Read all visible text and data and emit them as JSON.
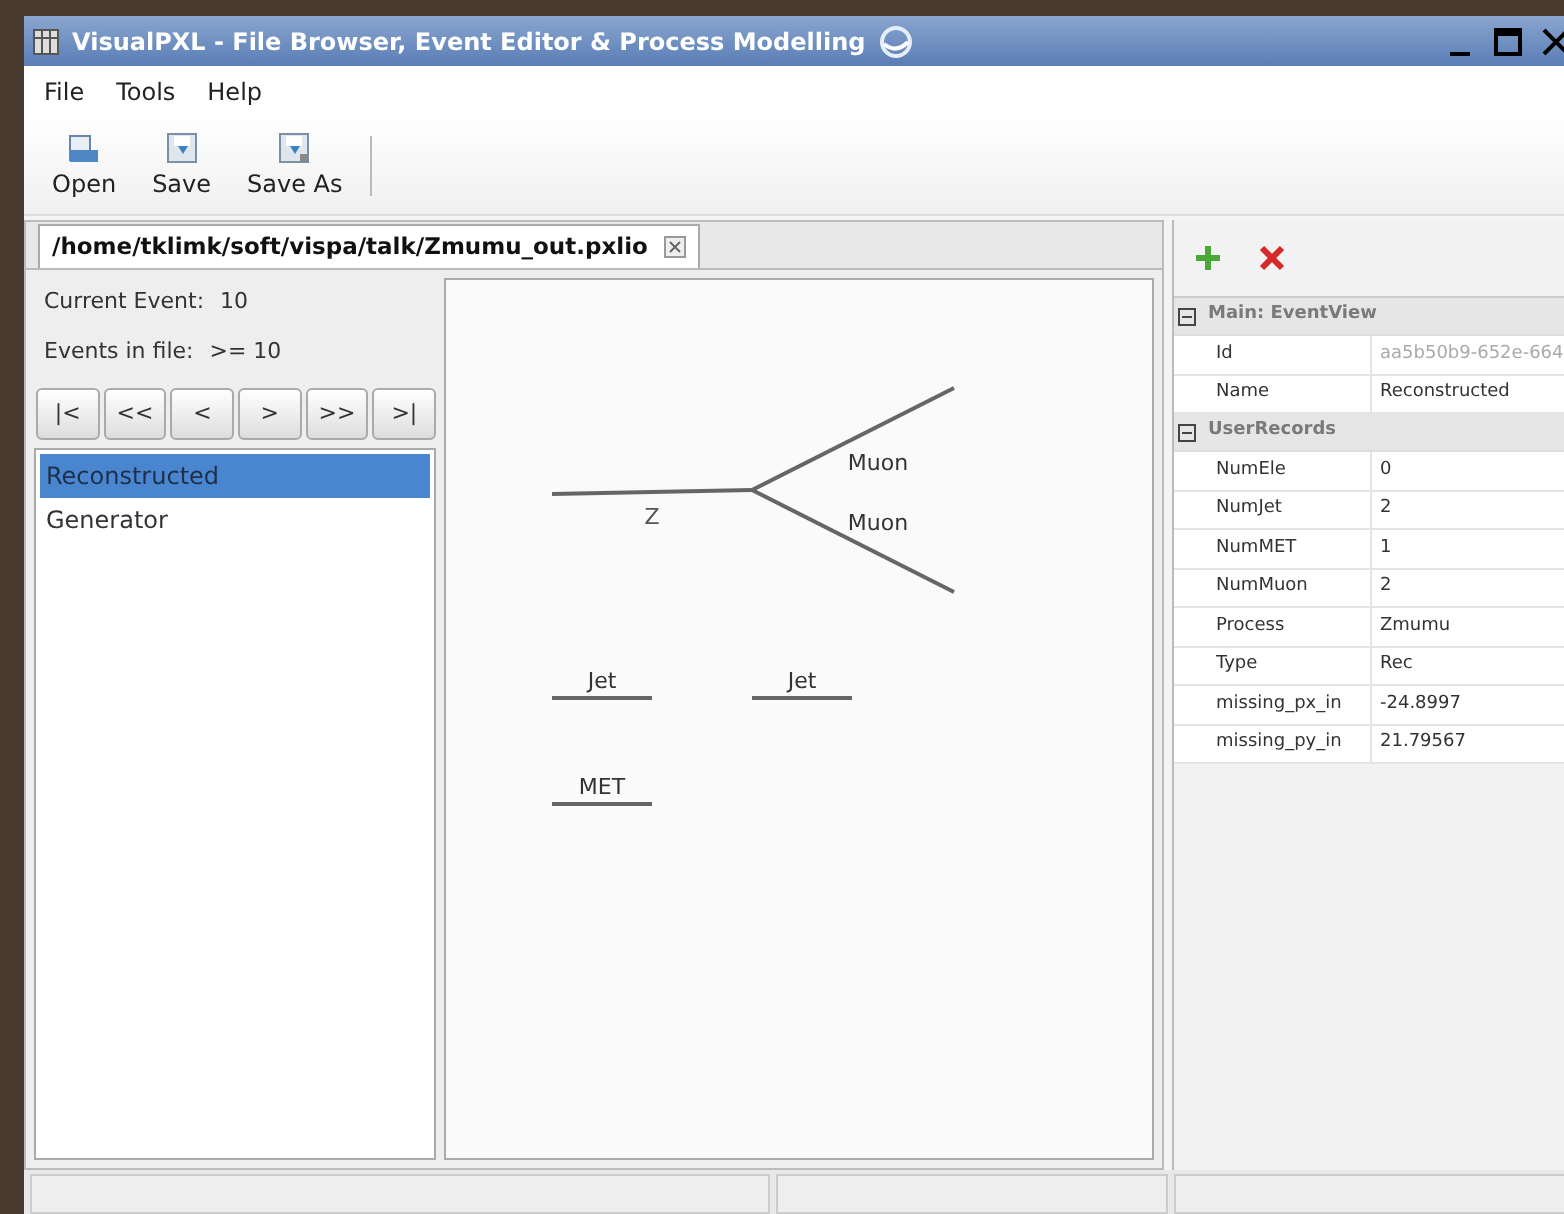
{
  "window": {
    "title": "VisualPXL - File Browser, Event Editor & Process Modelling"
  },
  "menu": [
    {
      "label": "File"
    },
    {
      "label": "Tools"
    },
    {
      "label": "Help"
    }
  ],
  "toolbar": [
    {
      "kind": "open",
      "label": "Open"
    },
    {
      "kind": "save",
      "label": "Save"
    },
    {
      "kind": "saveas",
      "label": "Save As"
    }
  ],
  "tabs": [
    {
      "label": "/home/tklimk/soft/vispa/talk/Zmumu_out.pxlio",
      "selected": true
    }
  ],
  "event_info": [
    {
      "label": "Current Event:",
      "value": "10"
    },
    {
      "label": "Events in file:",
      "value": ">= 10"
    }
  ],
  "nav_buttons": [
    "|<",
    "<<",
    "<",
    ">",
    ">>",
    ">|"
  ],
  "views": [
    {
      "label": "Reconstructed",
      "selected": true
    },
    {
      "label": "Generator",
      "selected": false
    }
  ],
  "diagram": {
    "decay": {
      "parent": "Z",
      "children": [
        "Muon",
        "Muon"
      ]
    },
    "objects": [
      "Jet",
      "Jet",
      "MET"
    ]
  },
  "properties": [
    {
      "title": "Main: EventView",
      "expanded": true,
      "rows": [
        {
          "name": "Id",
          "value": "aa5b50b9-652e-664",
          "readonly": true
        },
        {
          "name": "Name",
          "value": "Reconstructed",
          "readonly": false
        }
      ]
    },
    {
      "title": "UserRecords",
      "expanded": true,
      "rows": [
        {
          "name": "NumEle",
          "value": "0",
          "readonly": false
        },
        {
          "name": "NumJet",
          "value": "2",
          "readonly": false
        },
        {
          "name": "NumMET",
          "value": "1",
          "readonly": false
        },
        {
          "name": "NumMuon",
          "value": "2",
          "readonly": false
        },
        {
          "name": "Process",
          "value": "Zmumu",
          "readonly": false
        },
        {
          "name": "Type",
          "value": "Rec",
          "readonly": false
        },
        {
          "name": "missing_px_in",
          "value": "-24.8997",
          "readonly": false
        },
        {
          "name": "missing_py_in",
          "value": "21.79567",
          "readonly": false
        }
      ]
    }
  ]
}
